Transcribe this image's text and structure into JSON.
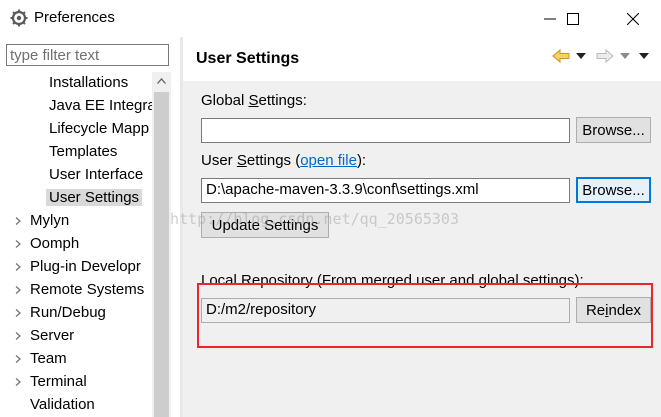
{
  "window": {
    "title": "Preferences",
    "icon": "eclipse-gear-icon",
    "controls": {
      "minimize": "minimize-icon",
      "maximize": "maximize-icon",
      "close": "close-icon"
    }
  },
  "filter": {
    "placeholder": "type filter text",
    "value": ""
  },
  "tree": {
    "items": [
      {
        "label": "Installations",
        "level": "child",
        "expandable": false,
        "selected": false
      },
      {
        "label": "Java EE Integra",
        "level": "child",
        "expandable": false,
        "selected": false
      },
      {
        "label": "Lifecycle Mapp",
        "level": "child",
        "expandable": false,
        "selected": false
      },
      {
        "label": "Templates",
        "level": "child",
        "expandable": false,
        "selected": false
      },
      {
        "label": "User Interface",
        "level": "child",
        "expandable": false,
        "selected": false
      },
      {
        "label": "User Settings",
        "level": "child",
        "expandable": false,
        "selected": true
      },
      {
        "label": "Mylyn",
        "level": "parent",
        "expandable": true,
        "selected": false
      },
      {
        "label": "Oomph",
        "level": "parent",
        "expandable": true,
        "selected": false
      },
      {
        "label": "Plug-in Developr",
        "level": "parent",
        "expandable": true,
        "selected": false
      },
      {
        "label": "Remote Systems",
        "level": "parent",
        "expandable": true,
        "selected": false
      },
      {
        "label": "Run/Debug",
        "level": "parent",
        "expandable": true,
        "selected": false
      },
      {
        "label": "Server",
        "level": "parent",
        "expandable": true,
        "selected": false
      },
      {
        "label": "Team",
        "level": "parent",
        "expandable": true,
        "selected": false
      },
      {
        "label": "Terminal",
        "level": "parent",
        "expandable": true,
        "selected": false
      },
      {
        "label": "Validation",
        "level": "parent",
        "expandable": false,
        "selected": false
      }
    ]
  },
  "page": {
    "title": "User Settings",
    "global_settings": {
      "label_pre": "Global ",
      "label_mnemonic": "S",
      "label_post": "ettings:",
      "value": "",
      "browse_pre": "Browse...",
      "browse_label": "Browse..."
    },
    "user_settings": {
      "label_pre": "User ",
      "label_mnemonic": "S",
      "label_post": "ettings (",
      "link": "open file",
      "label_end": "):",
      "value": "D:\\apache-maven-3.3.9\\conf\\settings.xml",
      "browse_label": "Browse..."
    },
    "update_button": "Update Settings",
    "local_repo": {
      "label": "Local Repository (From merged user and global settings):",
      "value": "D:/m2/repository",
      "reindex_pre": "Re",
      "reindex_mnemonic": "i",
      "reindex_post": "ndex"
    }
  },
  "watermark": "http://blog.csdn.net/qq_20565303",
  "colors": {
    "highlight": "#e8262b",
    "link": "#0066cc",
    "focus": "#0078d7",
    "back_arrow": "#e6b422"
  }
}
